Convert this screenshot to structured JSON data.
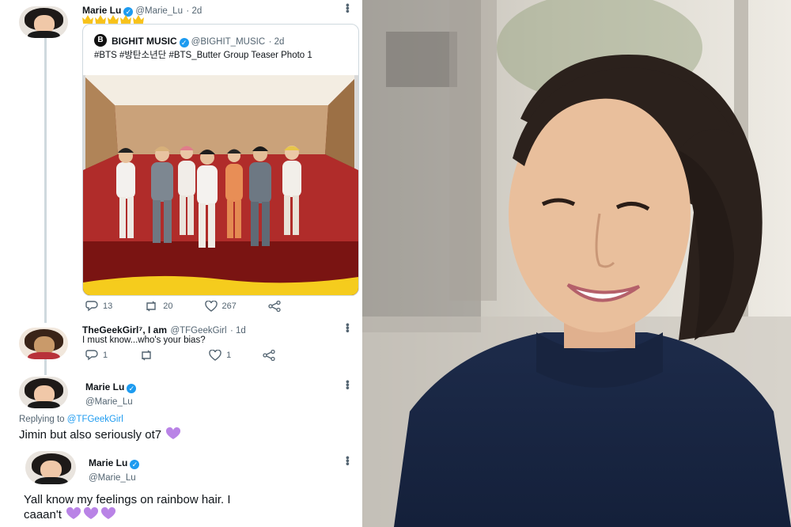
{
  "tweet1": {
    "name": "Marie Lu",
    "handle": "@Marie_Lu",
    "time": "· 2d",
    "emoji": "crown",
    "quoted": {
      "name": "BIGHIT MUSIC",
      "handle": "@BIGHIT_MUSIC",
      "time": "· 2d",
      "text": "#BTS #방탄소년단 #BTS_Butter Group Teaser Photo 1",
      "logo_letter": "B"
    },
    "replies": "13",
    "retweets": "20",
    "likes": "267"
  },
  "tweet2": {
    "name": "TheGeekGirl⁷, I am",
    "handle": "@TFGeekGirl",
    "time": "· 1d",
    "text": "I must know...who's your bias?",
    "replies": "1",
    "likes": "1"
  },
  "tweet3": {
    "name": "Marie Lu",
    "handle": "@Marie_Lu",
    "replying_label": "Replying to",
    "replying_to": "@TFGeekGirl",
    "text": "Jimin but also seriously ot7"
  },
  "tweet4": {
    "name": "Marie Lu",
    "handle": "@Marie_Lu",
    "text_line1": "Yall know my feelings on rainbow hair. I",
    "text_line2": "caaan't"
  },
  "colors": {
    "accent": "#1d9bf0",
    "heart_purple": "#b983e6",
    "muted": "#536471"
  }
}
